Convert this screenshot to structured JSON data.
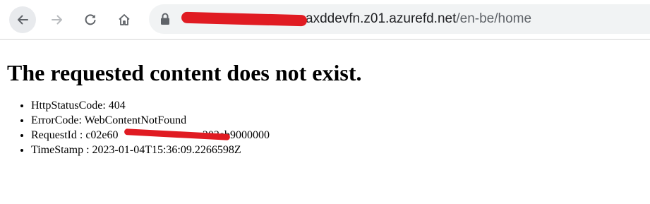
{
  "browser": {
    "url_host_visible": "axddevfn.z01.azurefd.net",
    "url_path": "/en-be/home",
    "icons": {
      "back": "back-arrow-icon",
      "forward": "forward-arrow-icon",
      "reload": "reload-icon",
      "home": "home-icon",
      "lock": "lock-icon"
    },
    "redaction_color": "#e01b22"
  },
  "page": {
    "heading": "The requested content does not exist.",
    "items": [
      "HttpStatusCode: 404",
      "ErrorCode: WebContentNotFound",
      "RequestId : c02e60",
      "TimeStamp : 2023-01-04T15:36:09.2266598Z"
    ],
    "request_id_tail": "-203eb9000000"
  }
}
